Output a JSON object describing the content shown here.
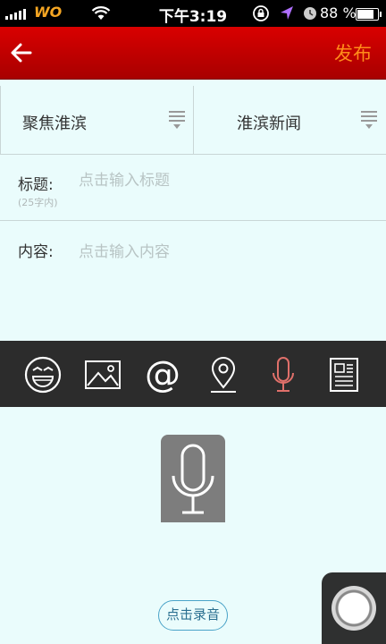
{
  "status_bar": {
    "carrier": "WO",
    "time": "下午3:19",
    "battery_text": "88 %",
    "battery_level": 0.88
  },
  "nav": {
    "back_icon": "back-arrow-icon",
    "publish_label": "发布"
  },
  "categories": {
    "left": "聚焦淮滨",
    "right": "淮滨新闻"
  },
  "form": {
    "title_label": "标题:",
    "title_placeholder": "点击输入标题",
    "title_hint": "(25字内)",
    "content_label": "内容:",
    "content_placeholder": "点击输入内容"
  },
  "toolbar": {
    "icons": [
      "emoji-icon",
      "image-icon",
      "mention-icon",
      "location-icon",
      "microphone-icon",
      "article-icon"
    ],
    "active_color": "#e0706a"
  },
  "voice": {
    "record_label": "点击录音"
  },
  "colors": {
    "nav_red": "#c00000",
    "publish_orange": "#ff8c1a",
    "background": "#eafcfc",
    "toolbar_bg": "#2c2c2c"
  }
}
